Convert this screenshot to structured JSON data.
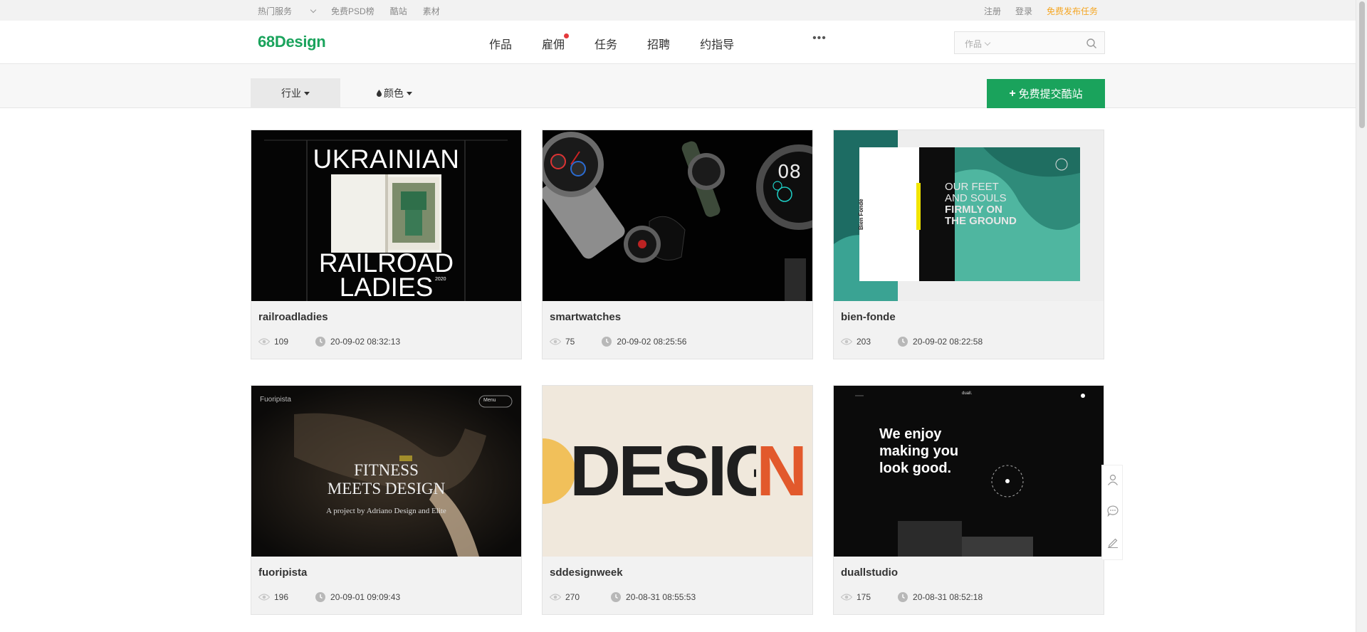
{
  "topbar": {
    "left_links": [
      "热门服务",
      "免费PSD榜",
      "酷站",
      "素材"
    ],
    "register": "注册",
    "login": "登录",
    "publish": "免费发布任务"
  },
  "header": {
    "logo": "68Design",
    "nav": [
      "作品",
      "雇佣",
      "任务",
      "招聘",
      "约指导"
    ],
    "more": "•••",
    "search_scope": "作品",
    "search_placeholder": ""
  },
  "filters": {
    "industry": "行业",
    "color": "颜色",
    "submit": "免费提交酷站",
    "submit_icon": "+"
  },
  "cards": [
    {
      "title": "railroadladies",
      "views": "109",
      "time": "20-09-02 08:32:13",
      "thumb": {
        "t1": "UKRAINIAN",
        "t2": "RAILROAD",
        "t3": "LADIES",
        "year": "2020"
      }
    },
    {
      "title": "smartwatches",
      "views": "75",
      "time": "20-09-02 08:25:56",
      "thumb": {
        "dial": "08"
      }
    },
    {
      "title": "bien-fonde",
      "views": "203",
      "time": "20-09-02 08:22:58",
      "thumb": {
        "l1": "OUR FEET",
        "l2": "AND SOULS",
        "l3": "FIRMLY ON",
        "l4": "THE GROUND",
        "brand": "Bien Fondé"
      }
    },
    {
      "title": "fuoripista",
      "views": "196",
      "time": "20-09-01 09:09:43",
      "thumb": {
        "brand": "Fuoripista",
        "menu": "Menu",
        "l1": "FITNESS",
        "l2": "MEETS DESIGN",
        "l3": "A project by Adriano Design and Elite"
      }
    },
    {
      "title": "sddesignweek",
      "views": "270",
      "time": "20-08-31 08:55:53",
      "thumb": {
        "word": "DESIGN"
      }
    },
    {
      "title": "duallstudio",
      "views": "175",
      "time": "20-08-31 08:52:18",
      "thumb": {
        "l1": "We enjoy",
        "l2": "making you",
        "l3": "look good.",
        "brand": "duall."
      }
    }
  ],
  "colors": {
    "brand_green": "#1aa35c",
    "accent_orange": "#f5a623",
    "badge_red": "#e4393c"
  }
}
